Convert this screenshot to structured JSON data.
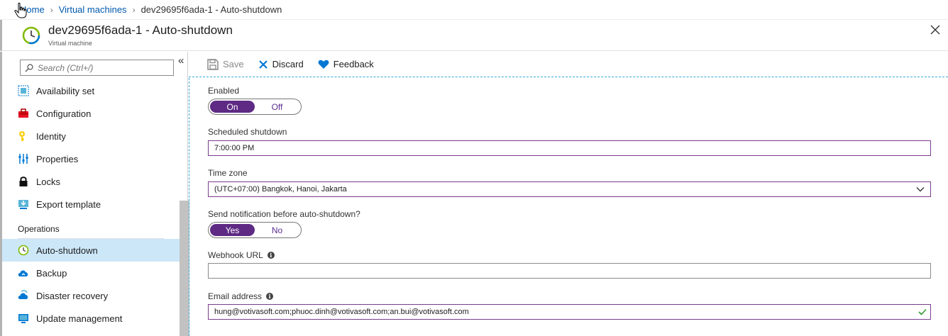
{
  "breadcrumb": {
    "home": "Home",
    "virtual_machines": "Virtual machines",
    "current": "dev29695f6ada-1 - Auto-shutdown"
  },
  "header": {
    "title": "dev29695f6ada-1 - Auto-shutdown",
    "subtitle": "Virtual machine"
  },
  "sidebar": {
    "search_placeholder": "Search (Ctrl+/)",
    "items_top": [
      {
        "label": "Availability set",
        "icon": "availability-set-icon"
      },
      {
        "label": "Configuration",
        "icon": "configuration-icon"
      },
      {
        "label": "Identity",
        "icon": "identity-icon"
      },
      {
        "label": "Properties",
        "icon": "properties-icon"
      },
      {
        "label": "Locks",
        "icon": "lock-icon"
      },
      {
        "label": "Export template",
        "icon": "export-template-icon"
      }
    ],
    "section_operations": "Operations",
    "items_ops": [
      {
        "label": "Auto-shutdown",
        "icon": "clock-icon",
        "active": true
      },
      {
        "label": "Backup",
        "icon": "backup-icon"
      },
      {
        "label": "Disaster recovery",
        "icon": "disaster-recovery-icon"
      },
      {
        "label": "Update management",
        "icon": "update-management-icon"
      }
    ]
  },
  "toolbar": {
    "save_label": "Save",
    "discard_label": "Discard",
    "feedback_label": "Feedback"
  },
  "form": {
    "enabled_label": "Enabled",
    "enabled_on": "On",
    "enabled_off": "Off",
    "enabled_value": "On",
    "scheduled_label": "Scheduled shutdown",
    "scheduled_value": "7:00:00 PM",
    "timezone_label": "Time zone",
    "timezone_value": "(UTC+07:00) Bangkok, Hanoi, Jakarta",
    "notify_label": "Send notification before auto-shutdown?",
    "notify_yes": "Yes",
    "notify_no": "No",
    "notify_value": "Yes",
    "webhook_label": "Webhook URL",
    "webhook_value": "",
    "email_label": "Email address",
    "email_value": "hung@votivasoft.com;phuoc.dinh@votivasoft.com;an.bui@votivasoft.com"
  },
  "colors": {
    "accent_purple": "#5e2a84",
    "link_blue": "#0058ad",
    "active_bg": "#cce7f8"
  }
}
